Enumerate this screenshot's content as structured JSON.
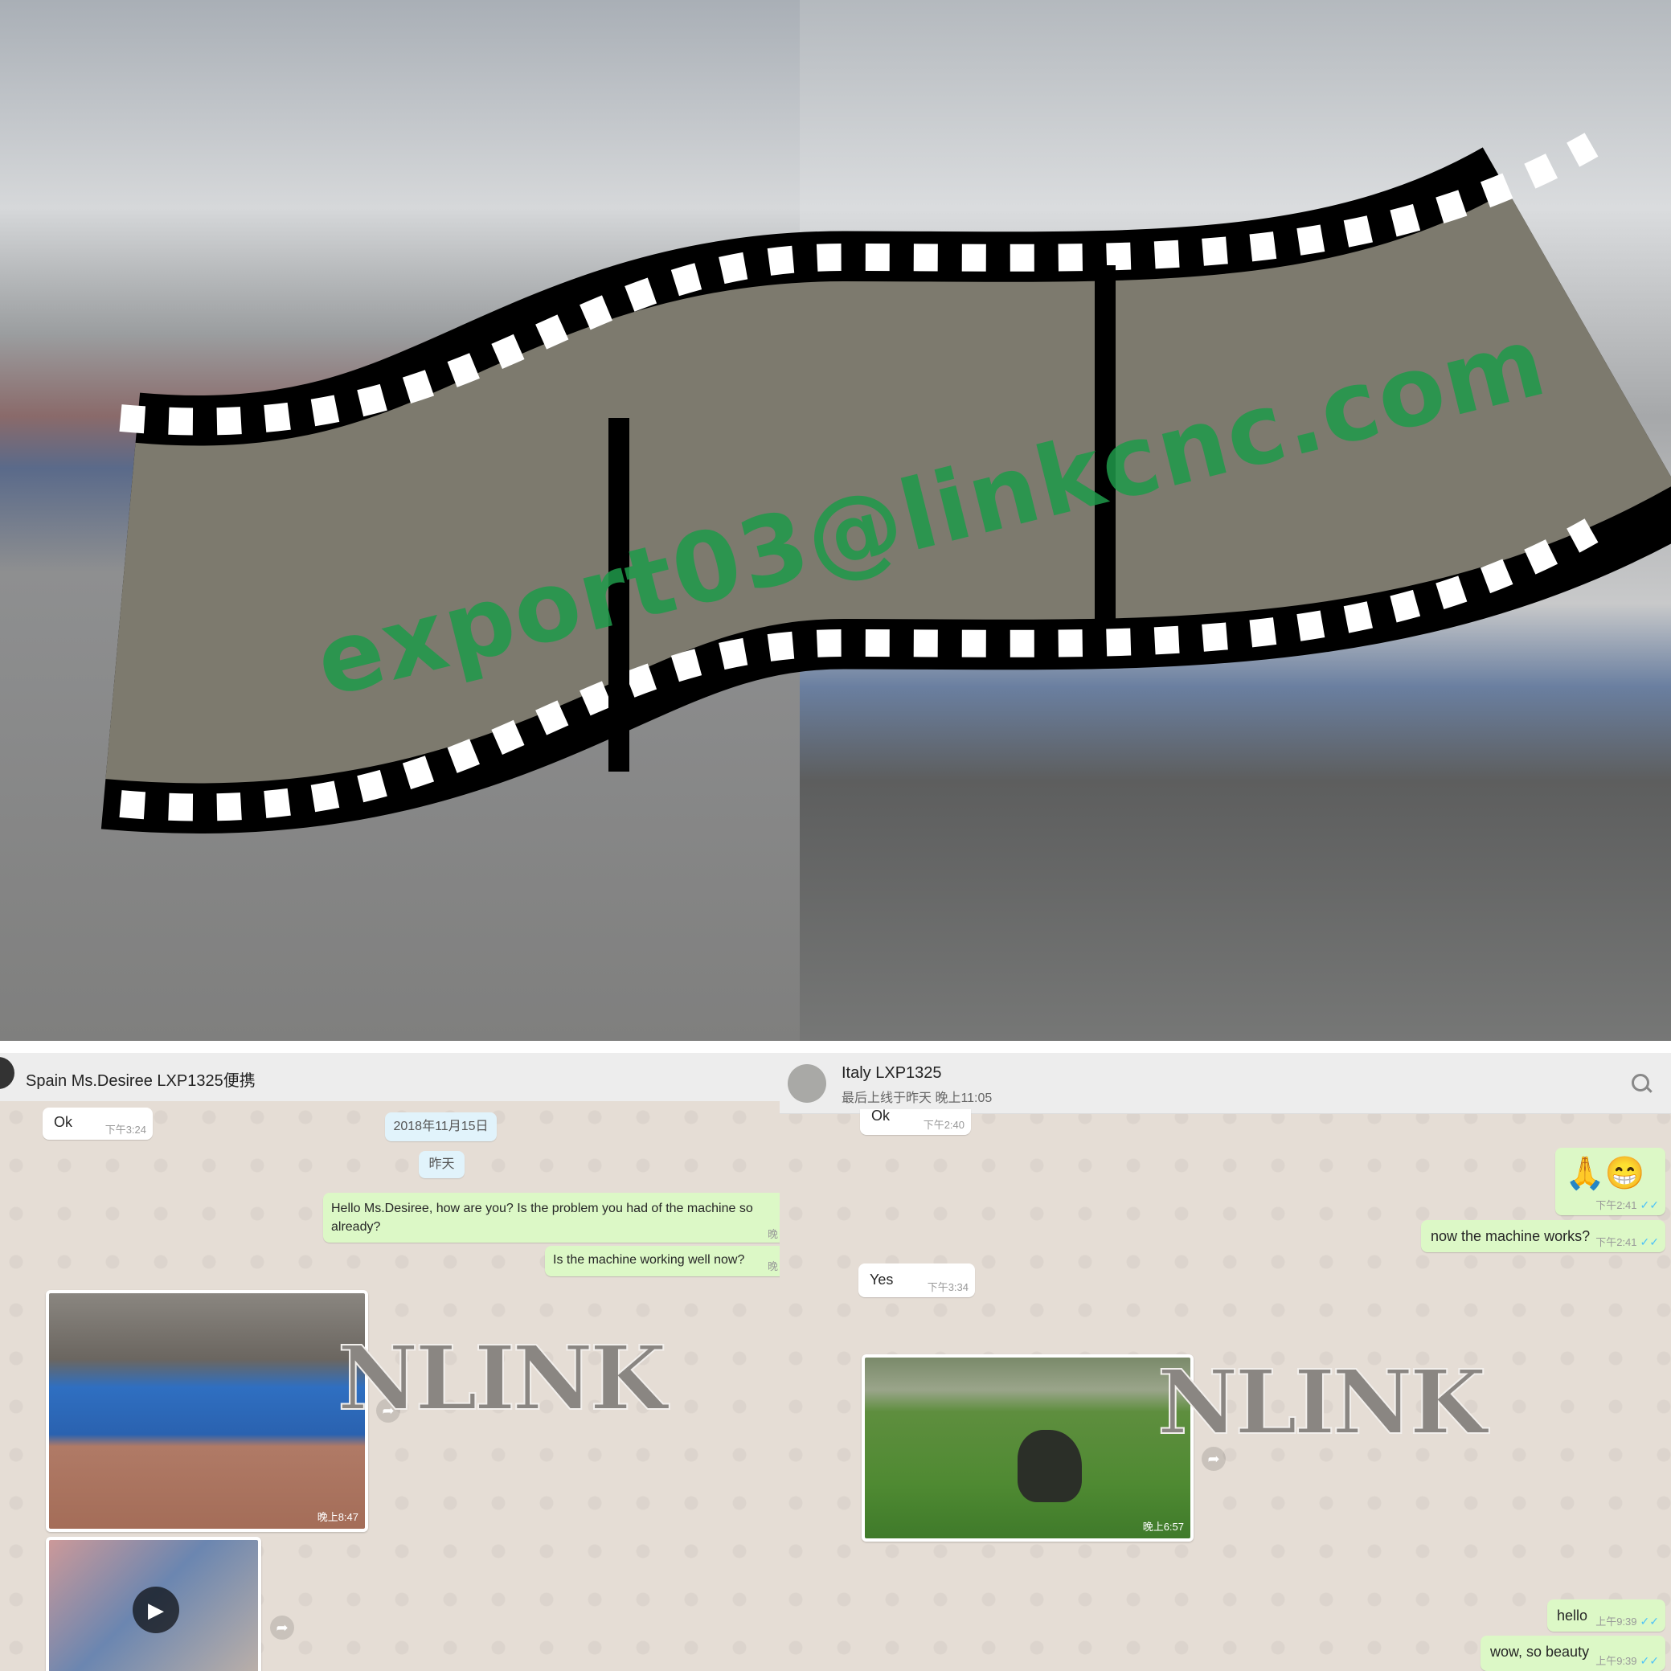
{
  "banner": {
    "watermark_email": "export03@linkcnc.com",
    "colors": {
      "watermark": "#1f9a4a",
      "film": "#000000"
    }
  },
  "left_chat": {
    "contact_name": "Spain Ms.Desiree LXP1325便携",
    "messages": [
      {
        "type": "in",
        "text": "Ok",
        "time": "下午3:24"
      },
      {
        "type": "date",
        "text": "2018年11月15日"
      },
      {
        "type": "date",
        "text": "昨天"
      },
      {
        "type": "out",
        "text": "Hello Ms.Desiree, how are you? Is the problem you had of the machine so already?",
        "time": "晚"
      },
      {
        "type": "out",
        "text": "Is the machine working well now?",
        "time": "晚"
      },
      {
        "type": "image",
        "time": "晚上8:47"
      },
      {
        "type": "video"
      }
    ],
    "watermark": "NLINK"
  },
  "right_chat": {
    "contact_name": "Italy LXP1325",
    "last_seen": "最后上线于昨天 晚上11:05",
    "search_icon": "search-icon",
    "messages": [
      {
        "type": "in",
        "text": "Ok",
        "time": "下午2:40"
      },
      {
        "type": "out",
        "text": "🙏😁",
        "time": "下午2:41"
      },
      {
        "type": "out",
        "text": "now the machine works?",
        "time": "下午2:41"
      },
      {
        "type": "in",
        "text": "Yes",
        "time": "下午3:34"
      },
      {
        "type": "image",
        "time": "晚上6:57"
      },
      {
        "type": "out",
        "text": "hello",
        "time": "上午9:39"
      },
      {
        "type": "out",
        "text": "wow, so beauty",
        "time": "上午9:39"
      }
    ],
    "watermark": "NLINK",
    "colors": {
      "outgoing": "#dcf8c6",
      "incoming": "#ffffff",
      "read_tick": "#4fc3f7"
    }
  }
}
